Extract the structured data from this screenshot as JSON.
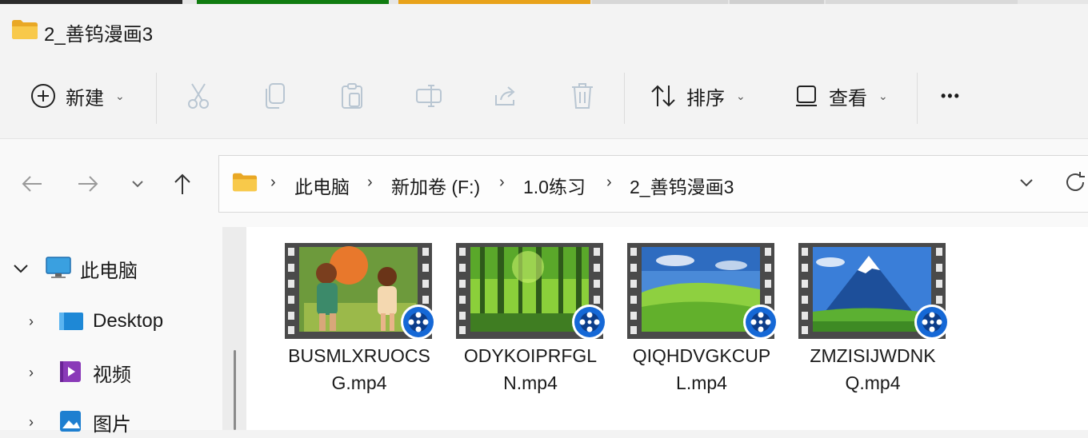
{
  "window": {
    "title": "2_善钨漫画3"
  },
  "toolbar": {
    "new_label": "新建",
    "sort_label": "排序",
    "view_label": "查看",
    "more_label": "•••"
  },
  "breadcrumb": [
    "此电脑",
    "新加卷 (F:)",
    "1.0练习",
    "2_善钨漫画3"
  ],
  "sidebar": {
    "items": [
      {
        "label": "此电脑",
        "icon": "computer-icon"
      },
      {
        "label": "Desktop",
        "icon": "desktop-icon"
      },
      {
        "label": "视频",
        "icon": "video-folder-icon"
      },
      {
        "label": "图片",
        "icon": "pictures-folder-icon"
      }
    ]
  },
  "files": [
    {
      "line1": "BUSMLXRUOCS",
      "line2": "G.mp4",
      "scene": "couple-cartoon"
    },
    {
      "line1": "ODYKOIPRFGL",
      "line2": "N.mp4",
      "scene": "forest"
    },
    {
      "line1": "QIQHDVGKCUP",
      "line2": "L.mp4",
      "scene": "meadow"
    },
    {
      "line1": "ZMZISIJWDNK",
      "line2": "Q.mp4",
      "scene": "mountain"
    }
  ],
  "colors": {
    "accent": "#0067c0",
    "folder": "#f5c242",
    "tab_green": "#107c10",
    "tab_orange": "#e8a21a"
  }
}
